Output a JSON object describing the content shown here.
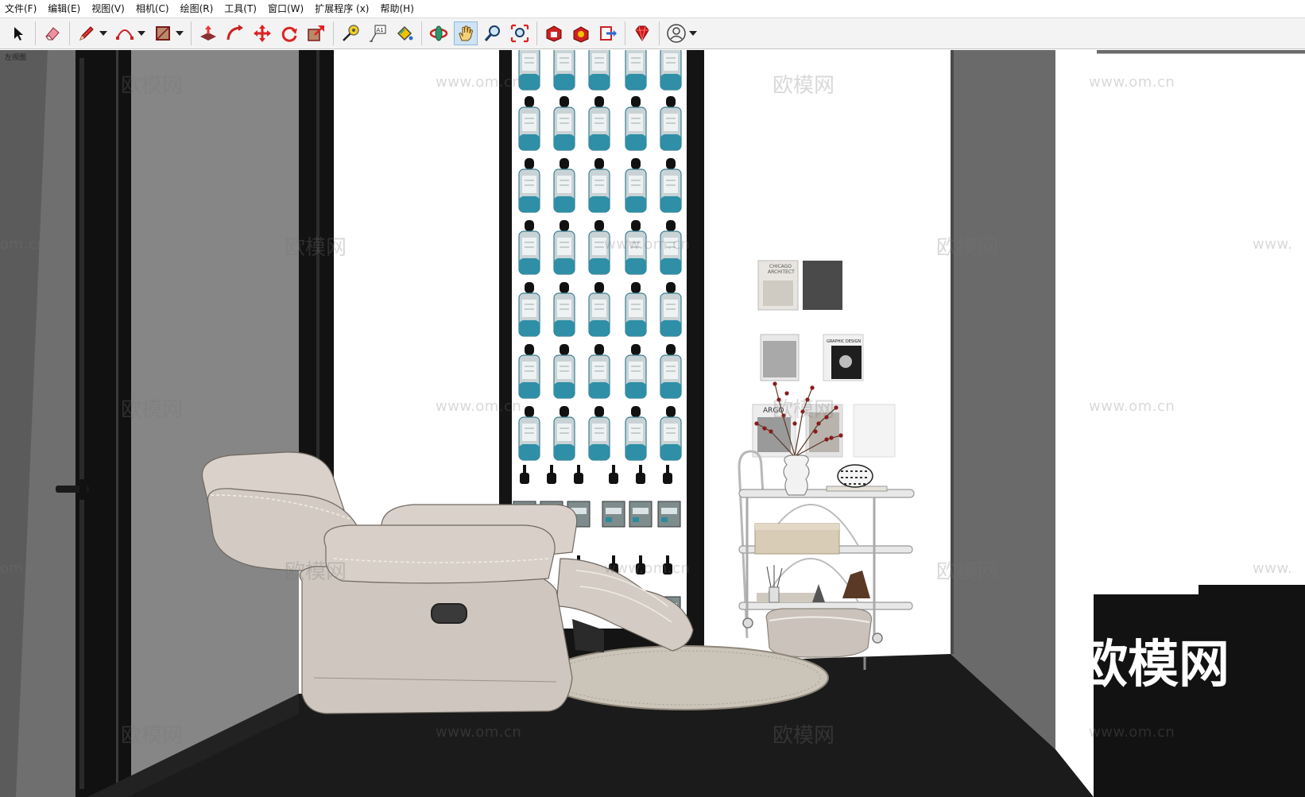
{
  "menu": [
    "文件(F)",
    "编辑(E)",
    "视图(V)",
    "相机(C)",
    "绘图(R)",
    "工具(T)",
    "窗口(W)",
    "扩展程序 (x)",
    "帮助(H)"
  ],
  "viewport": {
    "label": "左视图"
  },
  "wall_posters": {
    "poster1_lines": [
      "CHICAGO",
      "ARCHITECT"
    ],
    "poster3_title": "GRAPHIC DESIGN",
    "poster4_title": "ARGO"
  },
  "watermarks": {
    "brand": "欧模网",
    "url": "www.om.cn",
    "partial_url": "om.cn",
    "partial_url2": "www."
  },
  "colors": {
    "toolbar_bg": "#f3f3f3",
    "active_tool_bg": "#cfe3f5",
    "bottle_accent": "#2e8fa6",
    "floor": "#1b1b1b"
  }
}
